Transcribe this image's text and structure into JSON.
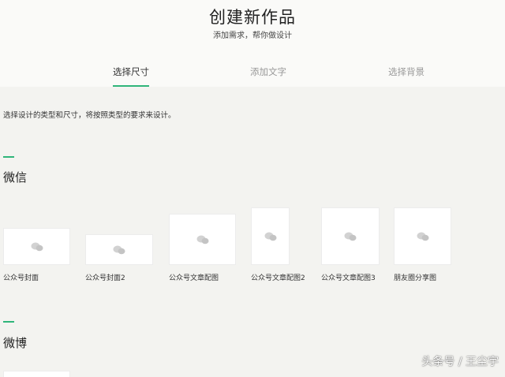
{
  "header": {
    "title": "创建新作品",
    "subtitle": "添加需求，帮你做设计"
  },
  "tabs": [
    {
      "label": "选择尺寸",
      "active": true
    },
    {
      "label": "添加文字",
      "active": false
    },
    {
      "label": "选择背景",
      "active": false
    }
  ],
  "description": "选择设计的类型和尺寸，将按照类型的要求来设计。",
  "sections": [
    {
      "title": "微信",
      "items": [
        {
          "label": "公众号封面"
        },
        {
          "label": "公众号封面2"
        },
        {
          "label": "公众号文章配图"
        },
        {
          "label": "公众号文章配图2"
        },
        {
          "label": "公众号文章配图3"
        },
        {
          "label": "朋友圈分享图"
        }
      ]
    },
    {
      "title": "微博",
      "items": []
    }
  ],
  "watermark": "头条号 / 王尘宇",
  "colors": {
    "accent": "#2fb57a",
    "background": "#f3f3f0",
    "header_background": "#fafaf8",
    "card": "#ffffff",
    "placeholder_icon": "#d2d2d2"
  },
  "icons": {
    "placeholder": "wechat-icon"
  }
}
